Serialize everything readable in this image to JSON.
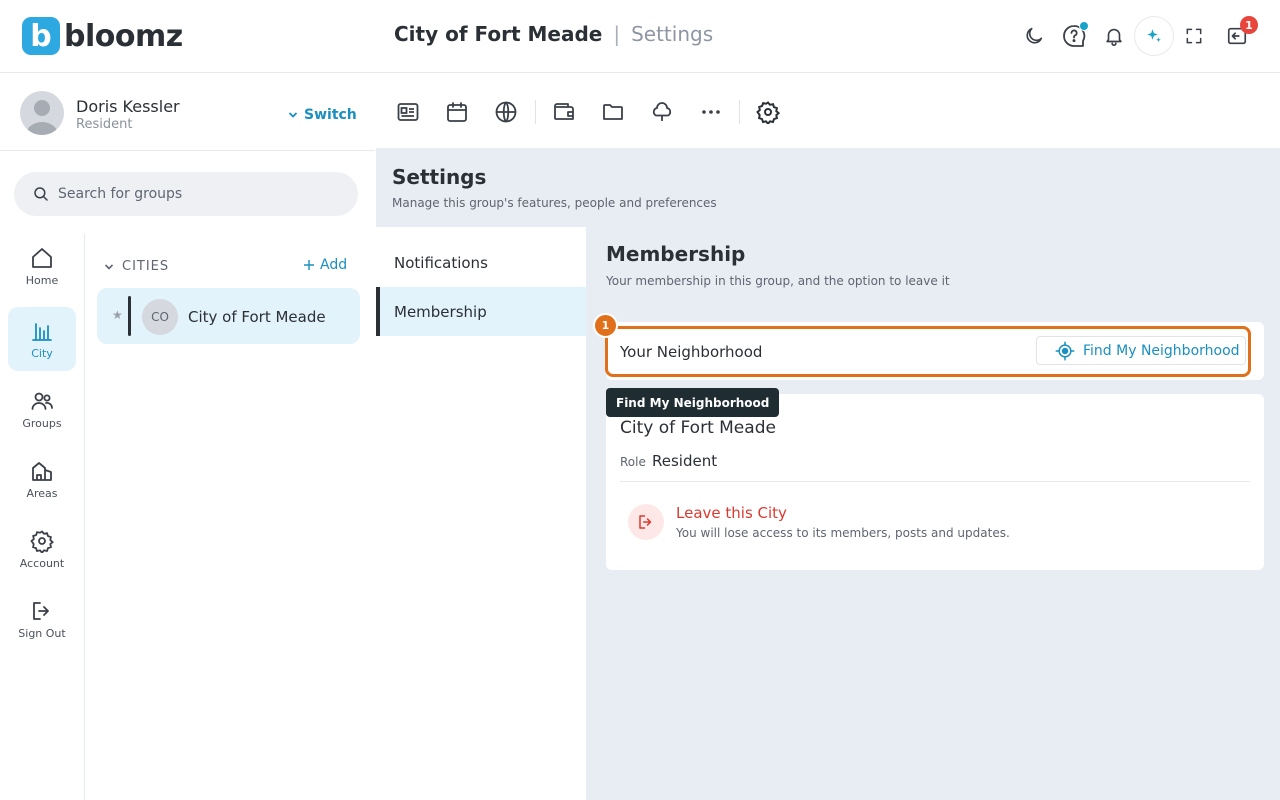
{
  "brand": {
    "logo_letter": "b",
    "name": "bloomz"
  },
  "header": {
    "group_title": "City of Fort Meade",
    "separator": "|",
    "section": "Settings",
    "notification_count": "1"
  },
  "user": {
    "name": "Doris Kessler",
    "role": "Resident",
    "switch_label": "Switch"
  },
  "search": {
    "placeholder": "Search for groups"
  },
  "leftnav": {
    "items": [
      {
        "label": "Home"
      },
      {
        "label": "City"
      },
      {
        "label": "Groups"
      },
      {
        "label": "Areas"
      },
      {
        "label": "Account"
      },
      {
        "label": "Sign Out"
      }
    ]
  },
  "groups_panel": {
    "section_label": "CITIES",
    "add_label": "Add",
    "items": [
      {
        "initials": "CO",
        "name": "City of Fort Meade"
      }
    ]
  },
  "settings": {
    "title": "Settings",
    "subtitle": "Manage this group's features, people and preferences",
    "nav": [
      {
        "label": "Notifications"
      },
      {
        "label": "Membership"
      }
    ]
  },
  "membership": {
    "title": "Membership",
    "subtitle": "Your membership in this group, and the option to leave it",
    "neighborhood_label": "Your Neighborhood",
    "find_button_label": "Find My Neighborhood",
    "step_number": "1",
    "tooltip": "Find My Neighborhood",
    "city_name": "City of Fort Meade",
    "role_label": "Role",
    "role_value": "Resident",
    "leave_title": "Leave this City",
    "leave_subtitle": "You will lose access to its members, posts and updates."
  },
  "colors": {
    "accent": "#1a8fc0",
    "highlight_outline": "#e0701a",
    "danger": "#d93a2f",
    "active_bg": "#e3f3fb",
    "content_bg": "#e8ecf3"
  }
}
